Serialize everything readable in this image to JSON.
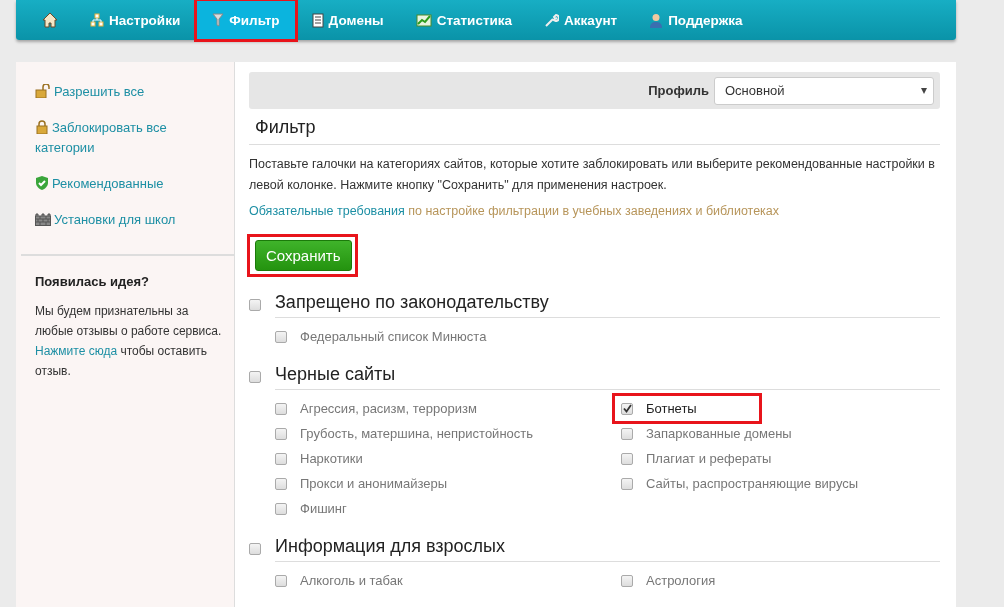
{
  "nav": [
    {
      "kind": "home",
      "selected": false,
      "highlighted": false
    },
    {
      "kind": "network",
      "label": "Настройки",
      "selected": false,
      "highlighted": false
    },
    {
      "kind": "filter",
      "label": "Фильтр",
      "selected": true,
      "highlighted": true
    },
    {
      "kind": "notebook",
      "label": "Домены",
      "selected": false,
      "highlighted": false
    },
    {
      "kind": "chart",
      "label": "Статистика",
      "selected": false,
      "highlighted": false
    },
    {
      "kind": "wrench",
      "label": "Аккаунт",
      "selected": false,
      "highlighted": false
    },
    {
      "kind": "person",
      "label": "Поддержка",
      "selected": false,
      "highlighted": false
    }
  ],
  "sidebar": {
    "items": [
      {
        "kind": "unlock",
        "label": "Разрешить все"
      },
      {
        "kind": "lock",
        "label": "Заблокировать все категории"
      },
      {
        "kind": "shield",
        "label": "Рекомендованные"
      },
      {
        "kind": "wall",
        "label": "Установки для школ"
      }
    ],
    "idea": {
      "title": "Появилась идея?",
      "text_before": "Мы будем признательны за любые отзывы о работе сервиса.",
      "link": "Нажмите сюда",
      "text_after": "чтобы оставить отзыв."
    }
  },
  "profile": {
    "label": "Профиль",
    "value": "Основной"
  },
  "title": "Фильтр",
  "description": "Поставьте галочки на категориях сайтов, которые хотите заблокировать или выберите рекомендованные настройки в левой колонке. Нажмите кнопку \"Сохранить\" для применения настроек.",
  "requirements": {
    "link": "Обязательные требования",
    "text": "по настройке фильтрации в учебных заведениях и библиотеках"
  },
  "save_button": {
    "label": "Сохранить",
    "highlighted": true
  },
  "groups": [
    {
      "label": "Запрещено по законодательству",
      "checked": false,
      "items": [
        {
          "label": "Федеральный список Минюста",
          "checked": false,
          "highlighted": false
        }
      ]
    },
    {
      "label": "Черные сайты",
      "checked": false,
      "items": [
        {
          "label": "Агрессия, расизм, терроризм",
          "checked": false,
          "highlighted": false
        },
        {
          "label": "Грубость, матершина, непристойность",
          "checked": false,
          "highlighted": false
        },
        {
          "label": "Наркотики",
          "checked": false,
          "highlighted": false
        },
        {
          "label": "Прокси и анонимайзеры",
          "checked": false,
          "highlighted": false
        },
        {
          "label": "Фишинг",
          "checked": false,
          "highlighted": false
        },
        {
          "label": "Ботнеты",
          "checked": true,
          "highlighted": true
        },
        {
          "label": "Запаркованные домены",
          "checked": false,
          "highlighted": false
        },
        {
          "label": "Плагиат и рефераты",
          "checked": false,
          "highlighted": false
        },
        {
          "label": "Сайты, распространяющие вирусы",
          "checked": false,
          "highlighted": false
        }
      ]
    },
    {
      "label": "Информация для взрослых",
      "checked": false,
      "items": [
        {
          "label": "Алкоголь и табак",
          "checked": false,
          "highlighted": false
        },
        {
          "label": "Астрология",
          "checked": false,
          "highlighted": false
        }
      ]
    }
  ]
}
